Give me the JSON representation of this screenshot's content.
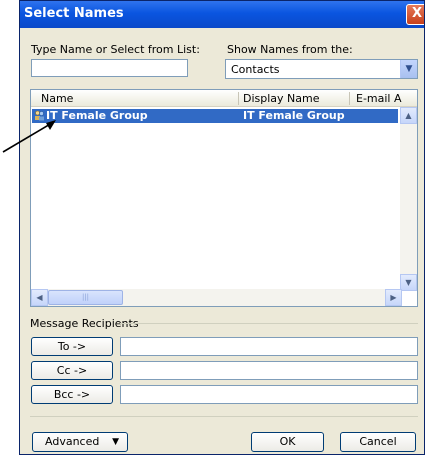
{
  "window": {
    "title": "Select Names",
    "close_glyph": "X"
  },
  "search": {
    "label": "Type Name or Select from List:",
    "value": ""
  },
  "source": {
    "label": "Show Names from the:",
    "selected": "Contacts"
  },
  "list": {
    "columns": [
      "Name",
      "Display Name",
      "E-mail A"
    ],
    "rows": [
      {
        "name": "IT Female Group",
        "display_name": "IT Female Group",
        "selected": true
      }
    ]
  },
  "recipients": {
    "label": "Message Recipients",
    "to_label": "To ->",
    "cc_label": "Cc ->",
    "bcc_label": "Bcc ->",
    "to_value": "",
    "cc_value": "",
    "bcc_value": ""
  },
  "footer": {
    "advanced_label": "Advanced",
    "ok_label": "OK",
    "cancel_label": "Cancel"
  }
}
